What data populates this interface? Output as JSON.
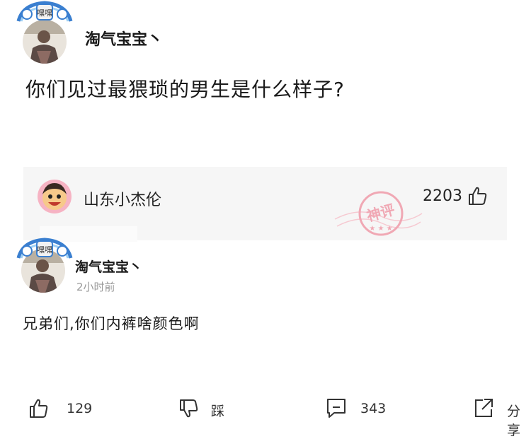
{
  "post": {
    "author": "淘气宝宝丶",
    "question": "你们见过最猥琐的男生是什么样子?",
    "avatar_badge": "嘿嘿"
  },
  "top_comment": {
    "author": "山东小杰伦",
    "likes": "2203",
    "stamp_text": "神评"
  },
  "reply": {
    "author": "淘气宝宝丶",
    "time": "2小时前",
    "text": "兄弟们,你们内裤啥颜色啊"
  },
  "actions": {
    "like_count": "129",
    "dislike_label": "踩",
    "comment_count": "343",
    "share_label": "分享"
  },
  "colors": {
    "stamp": "#f0a8b4",
    "card_bg": "#f6f6f6",
    "muted_text": "#999999"
  }
}
